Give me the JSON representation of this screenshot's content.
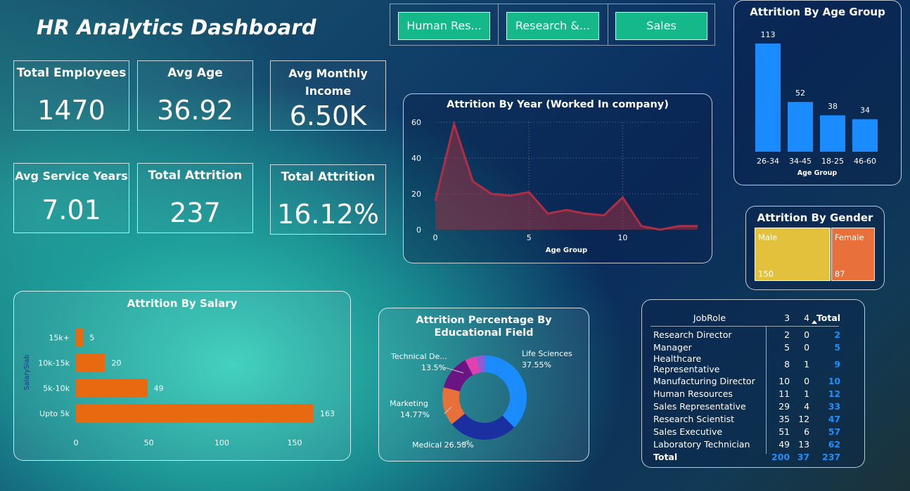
{
  "title": "HR Analytics Dashboard",
  "slicers": [
    "Human Res...",
    "Research &...",
    "Sales"
  ],
  "kpis": {
    "total_employees": {
      "label": "Total Employees",
      "value": "1470"
    },
    "avg_age": {
      "label": "Avg Age",
      "value": "36.92"
    },
    "avg_income": {
      "label": "Avg Monthly Income",
      "value": "6.50K"
    },
    "avg_service": {
      "label": "Avg Service Years",
      "value": "7.01"
    },
    "total_attrition": {
      "label": "Total Attrition",
      "value": "237"
    },
    "attrition_rate": {
      "label": "Total Attrition",
      "value": "16.12%"
    }
  },
  "chart_data": [
    {
      "type": "area",
      "title": "Attrition By Year (Worked In company)",
      "xlabel": "Age Group",
      "x": [
        0,
        1,
        2,
        3,
        4,
        5,
        6,
        7,
        8,
        9,
        10,
        11,
        12,
        13,
        14
      ],
      "values": [
        16,
        59,
        27,
        20,
        19,
        21,
        9,
        11,
        9,
        8,
        18,
        2,
        0,
        2,
        2
      ],
      "ylim": [
        0,
        60
      ],
      "yticks": [
        "0",
        "20",
        "40",
        "60"
      ],
      "xticks": [
        "0",
        "5",
        "10"
      ],
      "color": "#9a2f3e"
    },
    {
      "type": "bar",
      "title": "Attrition By Age Group",
      "xlabel": "Age Group",
      "categories": [
        "26-34",
        "34-45",
        "18-25",
        "46-60"
      ],
      "values": [
        113,
        52,
        38,
        34
      ],
      "color": "#1a8cff"
    },
    {
      "type": "treemap",
      "title": "Attrition By Gender",
      "categories": [
        "Male",
        "Female"
      ],
      "values": [
        150,
        87
      ],
      "colors": [
        "#e3c13c",
        "#e8703a"
      ]
    },
    {
      "type": "bar",
      "title": "Attrition By Salary",
      "ylabel": "SalarySlab",
      "categories": [
        "15k+",
        "10k-15k",
        "5k-10k",
        "Upto 5k"
      ],
      "values": [
        5,
        20,
        49,
        163
      ],
      "xticks": [
        "0",
        "50",
        "100",
        "150"
      ],
      "color": "#e8690f"
    },
    {
      "type": "pie",
      "title": "Attrition Percentage By Educational Field",
      "slices": [
        {
          "name": "Life Sciences",
          "value": 37.55,
          "label": "37.55%",
          "color": "#1a8cff"
        },
        {
          "name": "Medical",
          "value": 26.58,
          "label": "26.58%",
          "color": "#1c2fa0"
        },
        {
          "name": "Marketing",
          "value": 14.77,
          "label": "14.77%",
          "color": "#e8703a"
        },
        {
          "name": "Technical De...",
          "value": 13.5,
          "label": "13.5%",
          "color": "#6b1585"
        },
        {
          "name": "",
          "value": 4.6,
          "label": "",
          "color": "#e040b0"
        },
        {
          "name": "",
          "value": 3.0,
          "label": "",
          "color": "#8a5cd6"
        }
      ]
    }
  ],
  "table": {
    "headers": [
      "JobRole",
      "3",
      "4",
      "Total"
    ],
    "rows": [
      [
        "Research Director",
        "2",
        "0",
        "2"
      ],
      [
        "Manager",
        "5",
        "0",
        "5"
      ],
      [
        "Healthcare Representative",
        "8",
        "1",
        "9"
      ],
      [
        "Manufacturing Director",
        "10",
        "0",
        "10"
      ],
      [
        "Human Resources",
        "11",
        "1",
        "12"
      ],
      [
        "Sales Representative",
        "29",
        "4",
        "33"
      ],
      [
        "Research Scientist",
        "35",
        "12",
        "47"
      ],
      [
        "Sales Executive",
        "51",
        "6",
        "57"
      ],
      [
        "Laboratory Technician",
        "49",
        "13",
        "62"
      ]
    ],
    "total": [
      "Total",
      "200",
      "37",
      "237"
    ]
  }
}
